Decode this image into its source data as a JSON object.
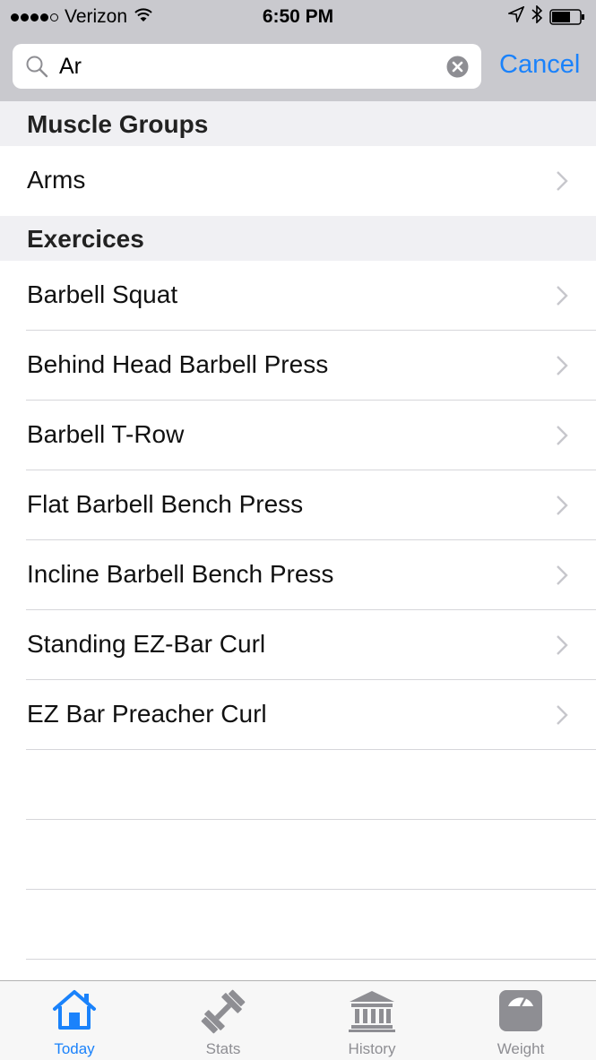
{
  "status_bar": {
    "carrier": "Verizon",
    "time": "6:50 PM"
  },
  "search": {
    "value": "Ar",
    "cancel_label": "Cancel"
  },
  "sections": {
    "muscle_groups": {
      "title": "Muscle Groups",
      "items": [
        "Arms"
      ]
    },
    "exercises": {
      "title": "Exercices",
      "items": [
        "Barbell Squat",
        "Behind Head Barbell Press",
        "Barbell T-Row",
        "Flat Barbell Bench Press",
        "Incline Barbell Bench Press",
        "Standing EZ-Bar Curl",
        "EZ Bar Preacher Curl"
      ]
    }
  },
  "tab_bar": {
    "tabs": [
      {
        "label": "Today",
        "icon": "home-icon",
        "active": true
      },
      {
        "label": "Stats",
        "icon": "dumbbell-icon",
        "active": false
      },
      {
        "label": "History",
        "icon": "bank-icon",
        "active": false
      },
      {
        "label": "Weight",
        "icon": "scale-icon",
        "active": false
      }
    ]
  },
  "colors": {
    "accent": "#1a82fb",
    "header_bg": "#c9c9ce",
    "section_bg": "#f0f0f3",
    "inactive_tab": "#8e8e93"
  }
}
